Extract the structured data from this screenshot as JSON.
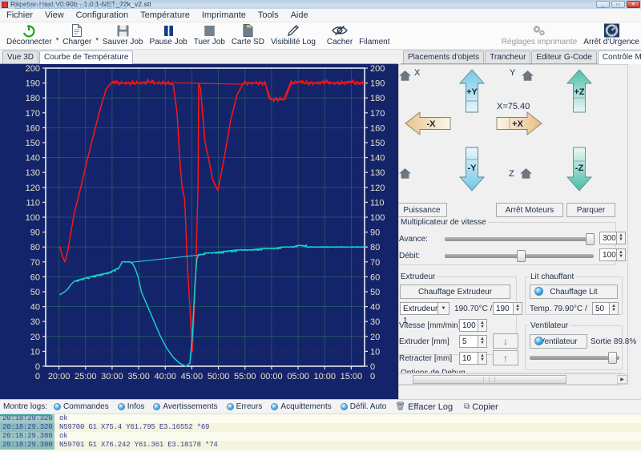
{
  "window": {
    "title": "Repetier-Host V0.90b - 1.0.1-NET_72k_v2.stl",
    "watermark": "Econologie.com forums",
    "buttons": {
      "minimize": "_",
      "maximize": "▭",
      "close": "✕"
    }
  },
  "menu": {
    "items": [
      "Fichier",
      "View",
      "Configuration",
      "Température",
      "Imprimante",
      "Tools",
      "Aide"
    ]
  },
  "toolbar": {
    "items": [
      {
        "label": "Déconnecter",
        "icon": "power-icon",
        "caret": true
      },
      {
        "label": "Charger",
        "icon": "document-icon",
        "caret": true
      },
      {
        "label": "Sauver Job",
        "icon": "floppy-icon",
        "caret": false
      },
      {
        "label": "Pause Job",
        "icon": "pause-icon",
        "caret": false
      },
      {
        "label": "Tuer Job",
        "icon": "stop-icon",
        "caret": false
      },
      {
        "label": "Carte SD",
        "icon": "sdcard-icon",
        "caret": false
      },
      {
        "label": "Visibilité Log",
        "icon": "pencil-icon",
        "caret": false
      },
      {
        "label": "Cacher",
        "icon": "eye-off-icon",
        "caret": false
      },
      {
        "label": "Filament",
        "icon": "filament-icon",
        "caret": false
      }
    ],
    "right_items": [
      {
        "label": "Réglages imprimante",
        "icon": "gears-icon"
      },
      {
        "label": "Arrêt d'Urgence",
        "icon": "emergency-stop-icon"
      }
    ]
  },
  "tabs_left": {
    "items": [
      {
        "label": "Vue 3D",
        "active": false
      },
      {
        "label": "Courbe de Température",
        "active": true
      }
    ]
  },
  "tabs_right": {
    "items": [
      {
        "label": "Placements d'objets",
        "active": false
      },
      {
        "label": "Trancheur",
        "active": false
      },
      {
        "label": "Editeur G-Code",
        "active": false
      },
      {
        "label": "Contrôle Manuel",
        "active": true
      }
    ]
  },
  "chart_data": {
    "type": "line",
    "title": "Courbe de Température",
    "xlabel": "",
    "ylabel": "",
    "background": "#14246b",
    "grid": true,
    "legend_position": "none",
    "ylim": [
      0,
      200
    ],
    "y_ticks": [
      0,
      10,
      20,
      30,
      40,
      50,
      60,
      70,
      80,
      90,
      100,
      110,
      120,
      130,
      140,
      150,
      160,
      170,
      180,
      190,
      200
    ],
    "y2_ticks": [
      0,
      10,
      20,
      30,
      40,
      50,
      60,
      70,
      80,
      90,
      100,
      110,
      120,
      130,
      140,
      150,
      160,
      170,
      180,
      190,
      200
    ],
    "x_tick_labels": [
      "20:00",
      "25:00",
      "30:00",
      "35:00",
      "40:00",
      "45:00",
      "50:00",
      "55:00",
      "00:00",
      "05:00",
      "10:00",
      "15:00"
    ],
    "series": [
      {
        "name": "Extrudeur",
        "color": "#ff1414",
        "x": [
          0.045,
          0.052,
          0.06,
          0.068,
          0.076,
          0.09,
          0.11,
          0.13,
          0.15,
          0.17,
          0.19,
          0.205,
          0.215,
          0.225,
          0.24,
          0.26,
          0.28,
          0.3,
          0.32,
          0.34,
          0.36,
          0.38,
          0.4,
          0.412,
          0.42,
          0.428,
          0.436,
          0.444,
          0.452,
          0.46,
          0.47,
          0.478,
          0.48,
          0.486,
          0.492,
          0.5,
          0.512,
          0.524,
          0.54,
          0.56,
          0.58,
          0.6,
          0.62,
          0.64,
          0.66,
          0.68,
          0.69,
          0.7,
          0.705,
          0.715,
          0.73,
          0.75,
          0.77,
          0.79,
          0.81,
          0.83,
          0.85,
          0.87,
          0.89,
          0.91,
          0.93,
          0.95,
          0.97,
          0.99,
          1.0
        ],
        "y": [
          80,
          74,
          70,
          76,
          86,
          103,
          120,
          138,
          155,
          172,
          186,
          190,
          191,
          190,
          190,
          190,
          190,
          190,
          191,
          190,
          190,
          190,
          189,
          170,
          140,
          120,
          112,
          70,
          40,
          10,
          60,
          120,
          190,
          186,
          170,
          150,
          138,
          125,
          118,
          140,
          165,
          182,
          190,
          190,
          190,
          190,
          189,
          180,
          179,
          179,
          179,
          179,
          190,
          191,
          190,
          190,
          190,
          191,
          190,
          190,
          190,
          191,
          190,
          190,
          190
        ]
      },
      {
        "name": "Lit chauffant",
        "color": "#18cfc8",
        "x": [
          0.045,
          0.06,
          0.07,
          0.08,
          0.09,
          0.105,
          0.12,
          0.14,
          0.16,
          0.18,
          0.2,
          0.21,
          0.22,
          0.23,
          0.24,
          0.25,
          0.262,
          0.272,
          0.28,
          0.29,
          0.3,
          0.32,
          0.34,
          0.36,
          0.38,
          0.4,
          0.42,
          0.44,
          0.452,
          0.46,
          0.468,
          0.474,
          0.48,
          0.486,
          0.492,
          0.5,
          0.52,
          0.56,
          0.6,
          0.64,
          0.68,
          0.7,
          0.72,
          0.74,
          0.76,
          0.775,
          0.79,
          0.8,
          0.82,
          0.86,
          0.9,
          0.94,
          0.97,
          1.0
        ],
        "y": [
          48,
          50,
          52,
          55,
          57,
          58,
          59,
          60,
          61,
          62,
          63,
          64,
          65,
          66,
          70,
          70,
          70,
          69,
          66,
          60,
          50,
          40,
          30,
          20,
          12,
          6,
          2,
          0,
          2,
          20,
          55,
          72,
          75,
          75,
          75,
          76,
          76,
          77,
          78,
          78,
          79,
          79,
          79,
          80,
          80,
          80,
          81,
          81,
          80,
          80,
          80,
          80,
          80,
          80
        ]
      }
    ]
  },
  "manual_control": {
    "axis_labels": {
      "x": "X",
      "y": "Y",
      "z": "Z"
    },
    "position_readout": "X=75.40",
    "jog_buttons": {
      "plus_x": "+X",
      "minus_x": "-X",
      "plus_y": "+Y",
      "minus_y": "-Y",
      "plus_z": "+Z",
      "minus_z": "-Z"
    },
    "buttons": {
      "power": "Puissance",
      "motors_off": "Arrêt Moteurs",
      "park": "Parquer"
    },
    "speed_group": {
      "title": "Multiplicateur de vitesse",
      "rows": [
        {
          "label": "Avance:",
          "value": "300",
          "slider_pct": 95
        },
        {
          "label": "Débit:",
          "value": "100",
          "slider_pct": 48
        }
      ]
    },
    "extruder_group": {
      "title": "Extrudeur",
      "heat_button": "Chauffage Extrudeur",
      "selector": "Extrudeur 1",
      "temp_current": "190.70°C /",
      "temp_target": "190",
      "rows": [
        {
          "label": "Vitesse [mm/min]",
          "value": "100",
          "button_icon": ""
        },
        {
          "label": "Extruder [mm]",
          "value": "5",
          "button_icon": "↓"
        },
        {
          "label": "Retracter [mm]",
          "value": "10",
          "button_icon": "↑"
        }
      ]
    },
    "bed_group": {
      "title": "Lit chauffant",
      "heat_button": "Chauffage Lit",
      "temp_label": "Temp.",
      "temp_current": "79.90°C /",
      "temp_target": "50"
    },
    "fan_group": {
      "title": "Ventilateur",
      "fan_button": "Ventilateur",
      "output_label": "Sortie 89.8%",
      "slider_pct": 90
    },
    "debug_group": {
      "title": "Options de Debug"
    }
  },
  "log_filters": {
    "label": "Montre logs:",
    "items": [
      "Commandes",
      "Infos",
      "Avertissements",
      "Erreurs",
      "Acquittements",
      "Défil. Auto"
    ],
    "actions": [
      {
        "label": "Effacer Log",
        "icon": "trash-icon"
      },
      {
        "label": "Copier",
        "icon": "copy-icon"
      }
    ]
  },
  "log": {
    "rows": [
      {
        "time": "20:18:29.320",
        "message": "ok"
      },
      {
        "time": "20:18:29.320",
        "message": "N59700 G1 X75.4 Y61.795 E3.16552 *69"
      },
      {
        "time": "20:18:29.380",
        "message": "ok"
      },
      {
        "time": "20:18:29.380",
        "message": "N59701 G1 X76.242 Y61.361 E3.18178 *74"
      }
    ]
  }
}
